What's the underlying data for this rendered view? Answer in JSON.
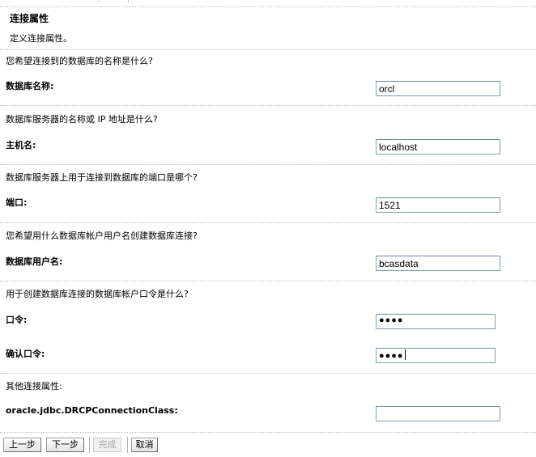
{
  "header": {
    "title": "连接属性",
    "description": "定义连接属性。"
  },
  "sections": [
    {
      "question": "您希望连接到的数据库的名称是什么?",
      "fields": [
        {
          "label": "数据库名称:",
          "value": "orcl"
        }
      ]
    },
    {
      "question": "数据库服务器的名称或 IP 地址是什么?",
      "fields": [
        {
          "label": "主机名:",
          "value": "localhost"
        }
      ]
    },
    {
      "question": "数据库服务器上用于连接到数据库的端口是哪个?",
      "fields": [
        {
          "label": "端口:",
          "value": "1521"
        }
      ]
    },
    {
      "question": "您希望用什么数据库帐户用户名创建数据库连接?",
      "fields": [
        {
          "label": "数据库用户名:",
          "value": "bcasdata"
        }
      ]
    },
    {
      "question": "用于创建数据库连接的数据库帐户口令是什么?",
      "fields": [
        {
          "label": "口令:",
          "value": "●●●●"
        },
        {
          "label": "确认口令:",
          "value": "●●●●"
        }
      ]
    },
    {
      "question": "其他连接属性:",
      "fields": [
        {
          "label": "oracle.jdbc.DRCPConnectionClass:",
          "value": ""
        }
      ]
    }
  ],
  "buttons": {
    "back": "上一步",
    "next": "下一步",
    "finish": "完成",
    "cancel": "取消"
  },
  "colors": {
    "input_border": "#7f9db9",
    "separator": "#b8b8b8",
    "disabled_text": "#a8a8a8"
  }
}
